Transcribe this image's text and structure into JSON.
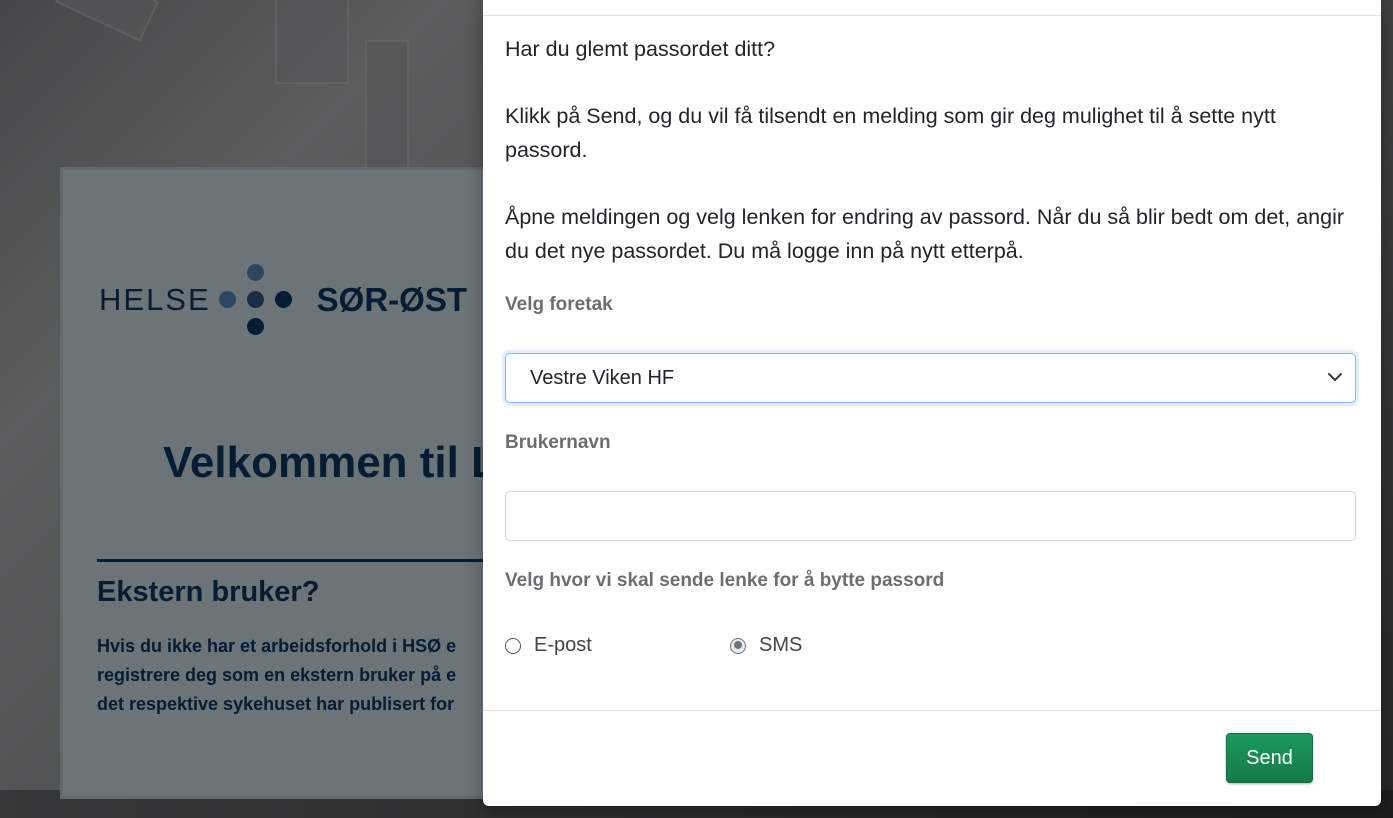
{
  "background": {
    "logo_left": "HELSE",
    "logo_right": "SØR-ØST",
    "welcome_title": "Velkommen til L",
    "external_title": "Ekstern bruker?",
    "external_text_lines": [
      "Hvis du ikke har et arbeidsforhold i HSØ e",
      "registrere deg som en ekstern bruker på e",
      "det respektive sykehuset har publisert for"
    ]
  },
  "modal": {
    "question": "Har du glemt passordet ditt?",
    "instruction_1": "Klikk på Send, og du vil få tilsendt en melding som gir deg mulighet til å sette nytt passord.",
    "instruction_2": "Åpne meldingen og velg lenken for endring av passord. Når du så blir bedt om det, angir du det nye passordet. Du må logge inn på nytt etterpå.",
    "foretak_label": "Velg foretak",
    "foretak_selected": "Vestre Viken HF",
    "username_label": "Brukernavn",
    "username_value": "",
    "send_via_label": "Velg hvor vi skal sende lenke for å bytte passord",
    "options": [
      {
        "label": "E-post",
        "checked": false
      },
      {
        "label": "SMS",
        "checked": true
      }
    ],
    "send_button": "Send"
  },
  "colors": {
    "brand_navy": "#0b3a66",
    "send_green": "#198754"
  }
}
